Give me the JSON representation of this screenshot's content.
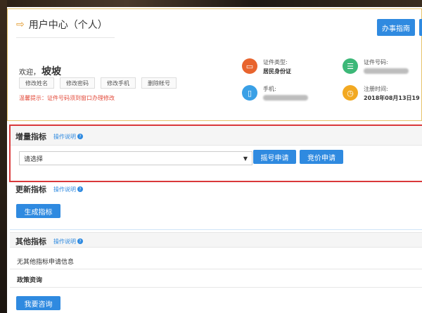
{
  "header": {
    "title": "用户中心（个人）",
    "guide_button": "办事指南"
  },
  "user": {
    "welcome_prefix": "欢迎，",
    "name": "坡坡",
    "actions": [
      "修改姓名",
      "修改密码",
      "修改手机",
      "删除帐号"
    ],
    "tip": "温馨提示：证件号码须到窗口办理修改"
  },
  "info": {
    "id_type_label": "证件类型:",
    "id_type_value": "居民身份证",
    "id_number_label": "证件号码:",
    "phone_label": "手机:",
    "register_label": "注册时间:",
    "register_value": "2018年08月13日19"
  },
  "increment": {
    "title": "增量指标",
    "help_link": "操作说明",
    "select_value": "请选择",
    "buttons": [
      "摇号申请",
      "竞价申请"
    ]
  },
  "update": {
    "title": "更新指标",
    "help_link": "操作说明",
    "button": "生成指标"
  },
  "other": {
    "title": "其他指标",
    "help_link": "操作说明",
    "empty_text": "无其他指标申请信息"
  },
  "policy": {
    "title": "政策资询",
    "button": "我要咨询"
  },
  "colors": {
    "primary": "#2f8ae0",
    "highlight_border": "#d9383a",
    "tip": "#e34b3b",
    "icon_orange": "#e8642e",
    "icon_green": "#3cb878",
    "icon_blue": "#3aa0e6",
    "icon_yellow": "#f2a922"
  }
}
